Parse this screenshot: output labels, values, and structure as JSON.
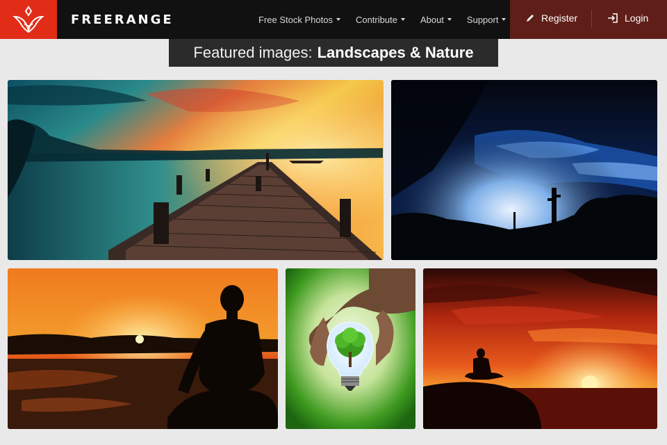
{
  "header": {
    "brand": "FREERANGE",
    "nav": [
      {
        "label": "Free Stock Photos"
      },
      {
        "label": "Contribute"
      },
      {
        "label": "About"
      },
      {
        "label": "Support"
      }
    ],
    "register_label": "Register",
    "login_label": "Login"
  },
  "featured": {
    "prefix": "Featured images:",
    "category": "Landscapes & Nature"
  },
  "colors": {
    "brand_red": "#e12d17",
    "auth_bg": "#5f1f18",
    "header_bg": "#111111",
    "page_bg": "#e9e9e9"
  },
  "gallery": [
    {
      "subject": "pier at sunset over lake"
    },
    {
      "subject": "stormy blue sky with cactus silhouettes"
    },
    {
      "subject": "meditating person silhouette at sunset"
    },
    {
      "subject": "hand holding light bulb with tree inside"
    },
    {
      "subject": "person meditating on rock at red sunset"
    }
  ]
}
